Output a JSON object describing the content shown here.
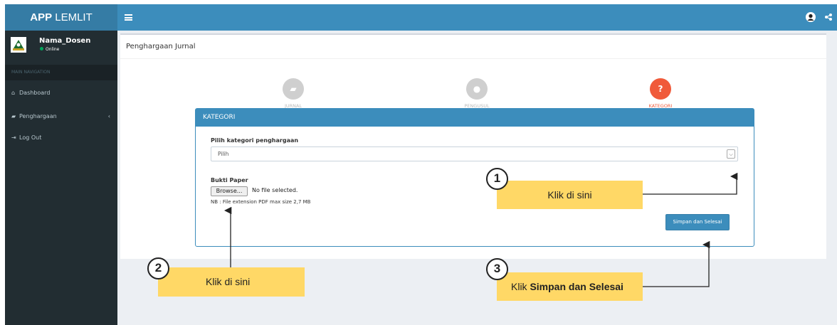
{
  "topbar": {
    "brand_bold": "APP",
    "brand_rest": " LEMLIT",
    "menu_icon": "hamburger-icon",
    "user_icon": "user-icon",
    "share_icon": "share-icon"
  },
  "sidebar": {
    "user_name": "Nama_Dosen",
    "user_status": "Online",
    "header": "MAIN NAVIGATION",
    "items": [
      {
        "label": "Dashboard",
        "icon": "home-icon"
      },
      {
        "label": "Penghargaan",
        "icon": "book-icon",
        "chevron": "‹"
      },
      {
        "label": "Log Out",
        "icon": "logout-icon"
      }
    ]
  },
  "content": {
    "title": "Penghargaan Jurnal",
    "steps": [
      {
        "label": "JURNAL",
        "icon": "book-icon",
        "glyph": "▰"
      },
      {
        "label": "PENGUSUL",
        "icon": "user-icon",
        "glyph": "●"
      },
      {
        "label": "KATEGORI",
        "icon": "question-icon",
        "glyph": "?"
      }
    ],
    "colors": {
      "step_inactive": "#cccccc",
      "step_active": "#f05a3a",
      "primary": "#3c8dbc"
    },
    "panel": {
      "heading": "KATEGORI",
      "category_label": "Pilih kategori penghargaan",
      "select_value": "Pilih",
      "select_arrow": "⌵",
      "bukti_label": "Bukti Paper",
      "browse_label": "Browse...",
      "no_file": "No file selected.",
      "note": "NB : File extension PDF max size 2,7 MB",
      "save_label": "Simpan dan Selesai"
    }
  },
  "annotations": {
    "a1": {
      "number": "1",
      "text": "Klik di sini"
    },
    "a2": {
      "number": "2",
      "text": "Klik di sini"
    },
    "a3": {
      "number": "3",
      "prefix": "Klik ",
      "bold": "Simpan dan Selesai"
    }
  }
}
